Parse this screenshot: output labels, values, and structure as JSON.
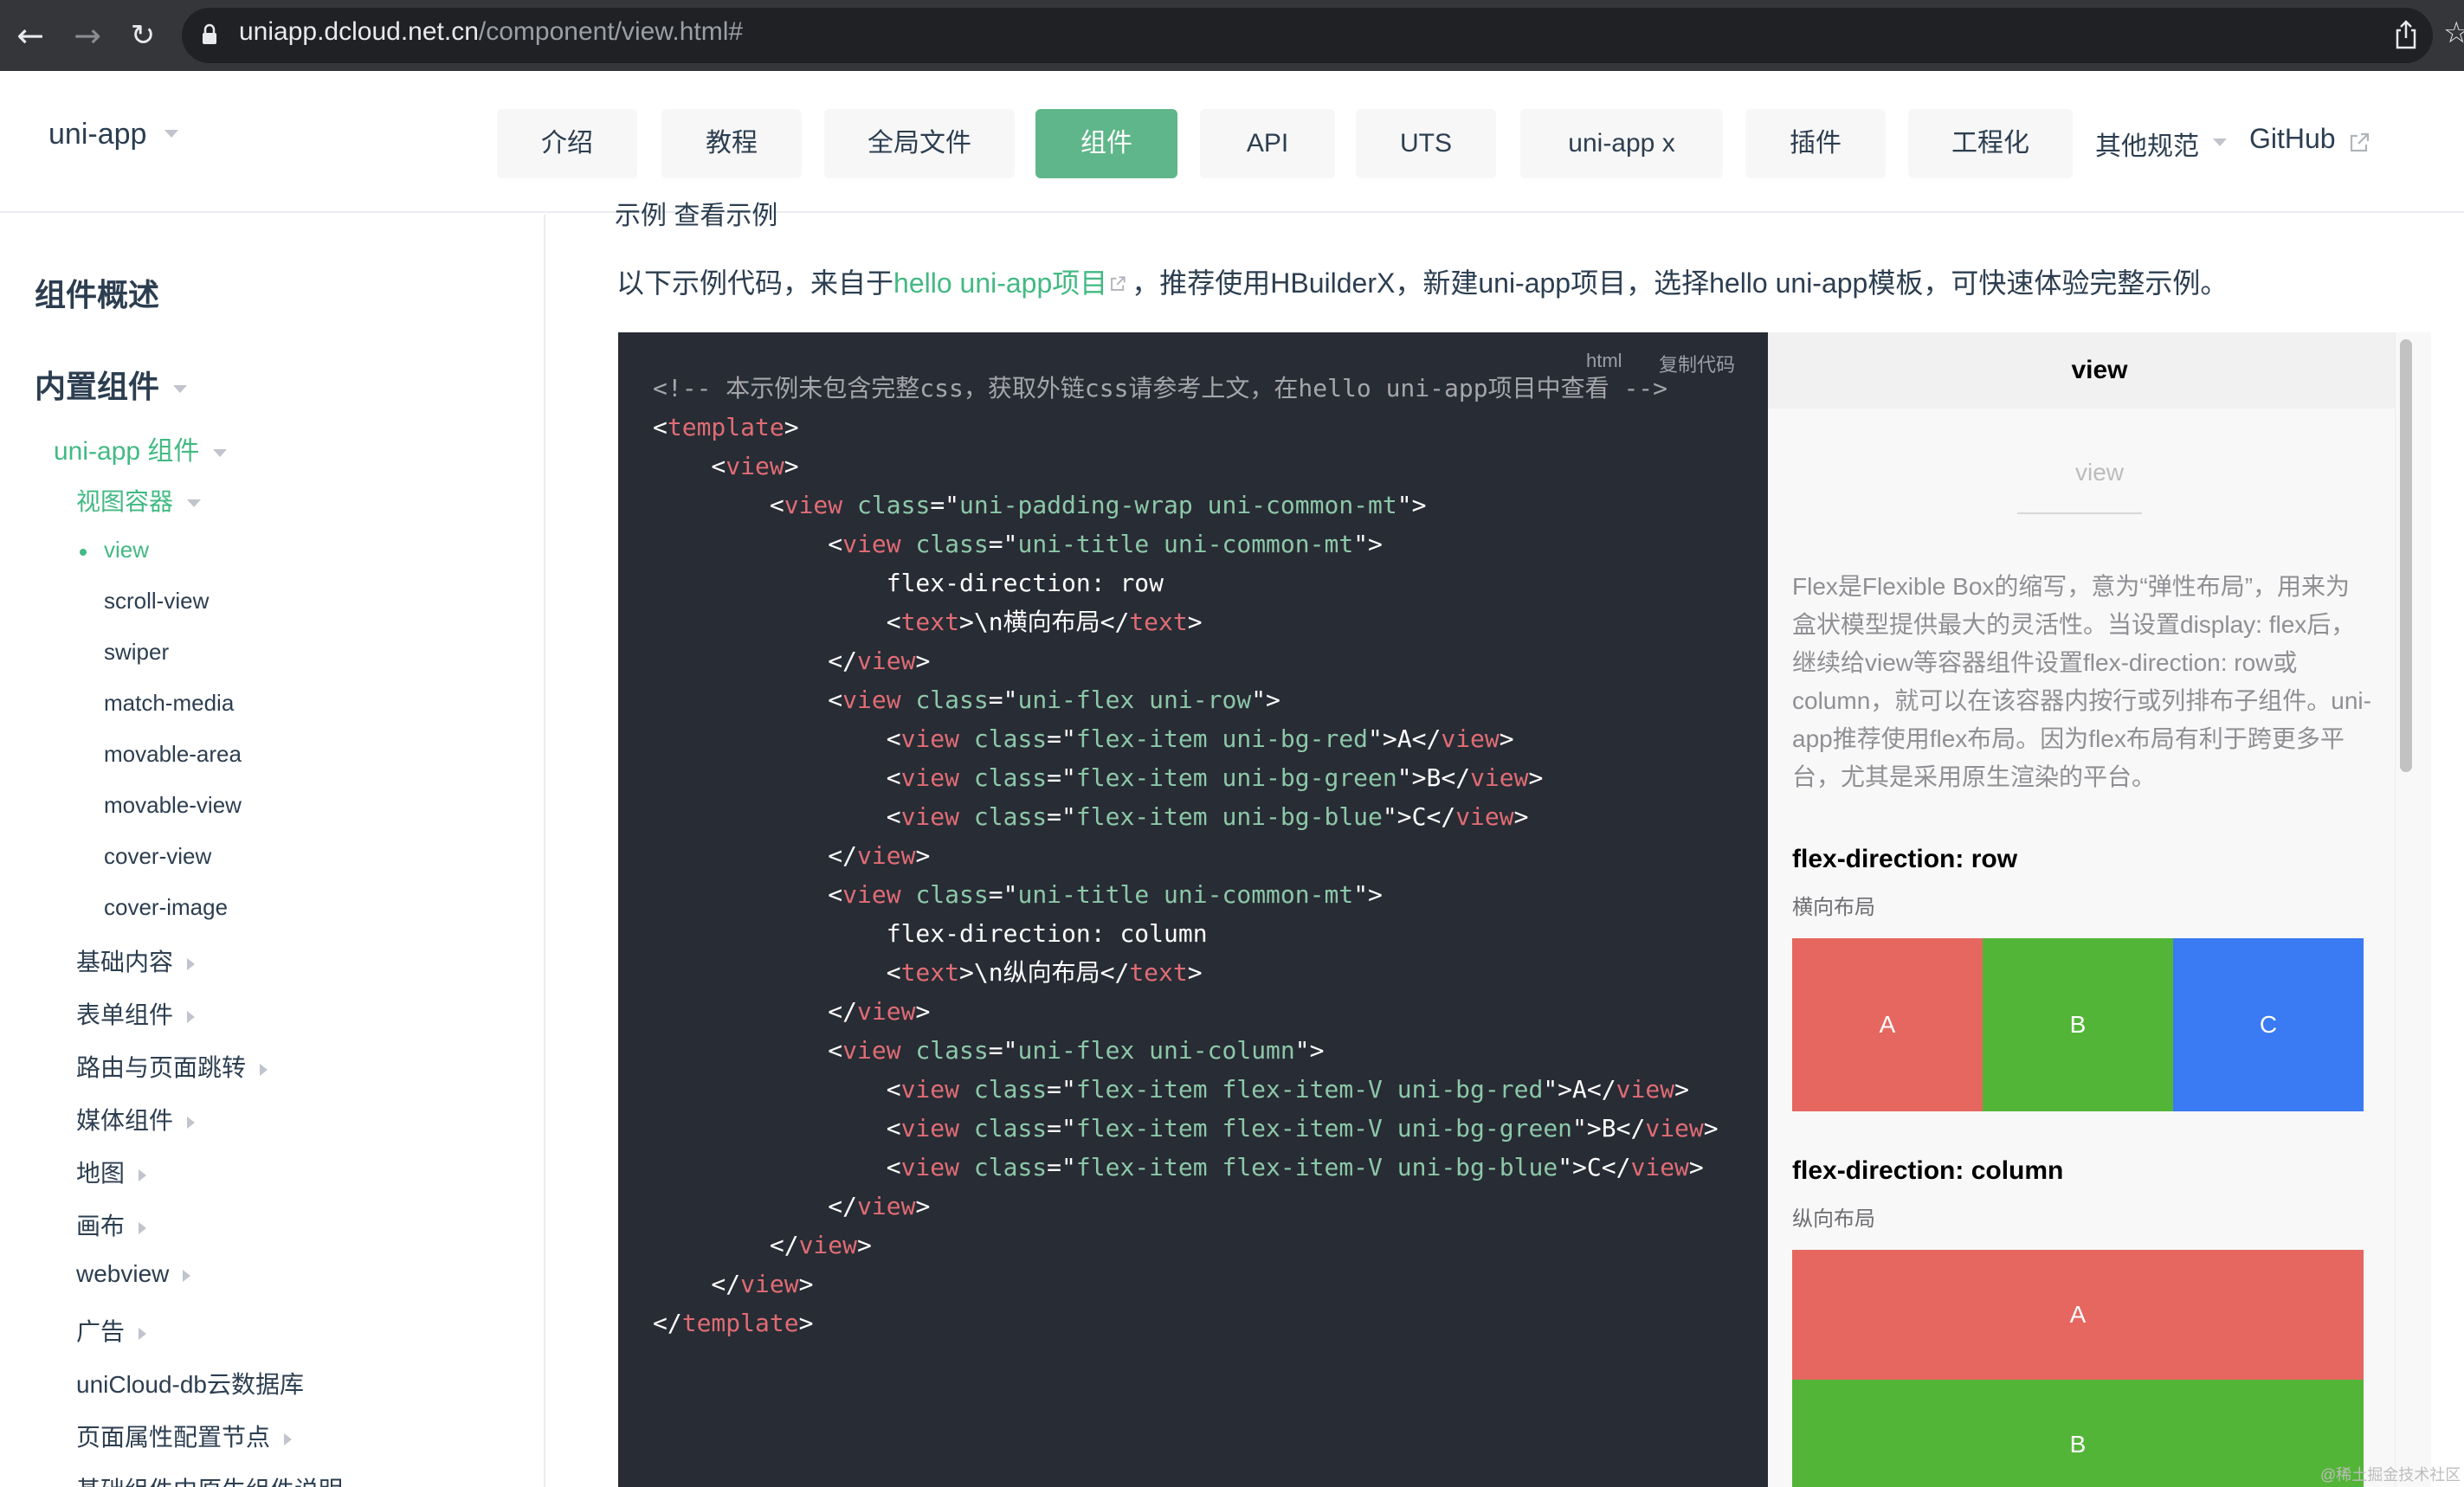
{
  "browser": {
    "url_host": "uniapp.dcloud.net.cn",
    "url_path": "/component/view.html#"
  },
  "navbar": {
    "brand": "uni-app",
    "tabs": [
      {
        "label": "介绍"
      },
      {
        "label": "教程"
      },
      {
        "label": "全局文件"
      },
      {
        "label": "组件",
        "active": true
      },
      {
        "label": "API"
      },
      {
        "label": "UTS"
      },
      {
        "label": "uni-app x"
      },
      {
        "label": "插件"
      },
      {
        "label": "工程化"
      }
    ],
    "other": "其他规范",
    "github": "GitHub"
  },
  "sidebar": {
    "overview": "组件概述",
    "builtin": "内置组件",
    "uniapp_components": "uni-app 组件",
    "view_containers": "视图容器",
    "items": [
      "view",
      "scroll-view",
      "swiper",
      "match-media",
      "movable-area",
      "movable-view",
      "cover-view",
      "cover-image"
    ],
    "groups": [
      "基础内容",
      "表单组件",
      "路由与页面跳转",
      "媒体组件",
      "地图",
      "画布",
      "webview",
      "广告"
    ],
    "extra": [
      "uniCloud-db云数据库",
      "页面属性配置节点",
      "基础组件中原生组件说明"
    ]
  },
  "main": {
    "partial_top": "示例 查看示例",
    "intro_prefix": "以下示例代码，来自于",
    "intro_link": "hello uni-app项目",
    "intro_suffix": "，推荐使用HBuilderX，新建uni-app项目，选择hello uni-app模板，可快速体验完整示例。",
    "code_lang": "html",
    "copy_label": "复制代码"
  },
  "code_lines": [
    [
      {
        "t": "com",
        "v": "<!-- 本示例未包含完整css，获取外链css请参考上文，在hello uni-app项目中查看 -->"
      }
    ],
    [
      {
        "t": "pun",
        "v": "<"
      },
      {
        "t": "tag",
        "v": "template"
      },
      {
        "t": "pun",
        "v": ">"
      }
    ],
    [
      {
        "t": "pun",
        "v": "    <"
      },
      {
        "t": "tag",
        "v": "view"
      },
      {
        "t": "pun",
        "v": ">"
      }
    ],
    [
      {
        "t": "pun",
        "v": "        <"
      },
      {
        "t": "tag",
        "v": "view"
      },
      {
        "t": "attr",
        "v": " class"
      },
      {
        "t": "pun",
        "v": "=\""
      },
      {
        "t": "str",
        "v": "uni-padding-wrap uni-common-mt"
      },
      {
        "t": "pun",
        "v": "\">"
      }
    ],
    [
      {
        "t": "pun",
        "v": "            <"
      },
      {
        "t": "tag",
        "v": "view"
      },
      {
        "t": "attr",
        "v": " class"
      },
      {
        "t": "pun",
        "v": "=\""
      },
      {
        "t": "str",
        "v": "uni-title uni-common-mt"
      },
      {
        "t": "pun",
        "v": "\">"
      }
    ],
    [
      {
        "t": "pun",
        "v": "                flex-direction: row"
      }
    ],
    [
      {
        "t": "pun",
        "v": "                <"
      },
      {
        "t": "tag",
        "v": "text"
      },
      {
        "t": "pun",
        "v": ">\\n横向布局</"
      },
      {
        "t": "tag",
        "v": "text"
      },
      {
        "t": "pun",
        "v": ">"
      }
    ],
    [
      {
        "t": "pun",
        "v": "            </"
      },
      {
        "t": "tag",
        "v": "view"
      },
      {
        "t": "pun",
        "v": ">"
      }
    ],
    [
      {
        "t": "pun",
        "v": "            <"
      },
      {
        "t": "tag",
        "v": "view"
      },
      {
        "t": "attr",
        "v": " class"
      },
      {
        "t": "pun",
        "v": "=\""
      },
      {
        "t": "str",
        "v": "uni-flex uni-row"
      },
      {
        "t": "pun",
        "v": "\">"
      }
    ],
    [
      {
        "t": "pun",
        "v": "                <"
      },
      {
        "t": "tag",
        "v": "view"
      },
      {
        "t": "attr",
        "v": " class"
      },
      {
        "t": "pun",
        "v": "=\""
      },
      {
        "t": "str",
        "v": "flex-item uni-bg-red"
      },
      {
        "t": "pun",
        "v": "\">A</"
      },
      {
        "t": "tag",
        "v": "view"
      },
      {
        "t": "pun",
        "v": ">"
      }
    ],
    [
      {
        "t": "pun",
        "v": "                <"
      },
      {
        "t": "tag",
        "v": "view"
      },
      {
        "t": "attr",
        "v": " class"
      },
      {
        "t": "pun",
        "v": "=\""
      },
      {
        "t": "str",
        "v": "flex-item uni-bg-green"
      },
      {
        "t": "pun",
        "v": "\">B</"
      },
      {
        "t": "tag",
        "v": "view"
      },
      {
        "t": "pun",
        "v": ">"
      }
    ],
    [
      {
        "t": "pun",
        "v": "                <"
      },
      {
        "t": "tag",
        "v": "view"
      },
      {
        "t": "attr",
        "v": " class"
      },
      {
        "t": "pun",
        "v": "=\""
      },
      {
        "t": "str",
        "v": "flex-item uni-bg-blue"
      },
      {
        "t": "pun",
        "v": "\">C</"
      },
      {
        "t": "tag",
        "v": "view"
      },
      {
        "t": "pun",
        "v": ">"
      }
    ],
    [
      {
        "t": "pun",
        "v": "            </"
      },
      {
        "t": "tag",
        "v": "view"
      },
      {
        "t": "pun",
        "v": ">"
      }
    ],
    [
      {
        "t": "pun",
        "v": "            <"
      },
      {
        "t": "tag",
        "v": "view"
      },
      {
        "t": "attr",
        "v": " class"
      },
      {
        "t": "pun",
        "v": "=\""
      },
      {
        "t": "str",
        "v": "uni-title uni-common-mt"
      },
      {
        "t": "pun",
        "v": "\">"
      }
    ],
    [
      {
        "t": "pun",
        "v": "                flex-direction: column"
      }
    ],
    [
      {
        "t": "pun",
        "v": "                <"
      },
      {
        "t": "tag",
        "v": "text"
      },
      {
        "t": "pun",
        "v": ">\\n纵向布局</"
      },
      {
        "t": "tag",
        "v": "text"
      },
      {
        "t": "pun",
        "v": ">"
      }
    ],
    [
      {
        "t": "pun",
        "v": "            </"
      },
      {
        "t": "tag",
        "v": "view"
      },
      {
        "t": "pun",
        "v": ">"
      }
    ],
    [
      {
        "t": "pun",
        "v": "            <"
      },
      {
        "t": "tag",
        "v": "view"
      },
      {
        "t": "attr",
        "v": " class"
      },
      {
        "t": "pun",
        "v": "=\""
      },
      {
        "t": "str",
        "v": "uni-flex uni-column"
      },
      {
        "t": "pun",
        "v": "\">"
      }
    ],
    [
      {
        "t": "pun",
        "v": "                <"
      },
      {
        "t": "tag",
        "v": "view"
      },
      {
        "t": "attr",
        "v": " class"
      },
      {
        "t": "pun",
        "v": "=\""
      },
      {
        "t": "str",
        "v": "flex-item flex-item-V uni-bg-red"
      },
      {
        "t": "pun",
        "v": "\">A</"
      },
      {
        "t": "tag",
        "v": "view"
      },
      {
        "t": "pun",
        "v": ">"
      }
    ],
    [
      {
        "t": "pun",
        "v": "                <"
      },
      {
        "t": "tag",
        "v": "view"
      },
      {
        "t": "attr",
        "v": " class"
      },
      {
        "t": "pun",
        "v": "=\""
      },
      {
        "t": "str",
        "v": "flex-item flex-item-V uni-bg-green"
      },
      {
        "t": "pun",
        "v": "\">B</"
      },
      {
        "t": "tag",
        "v": "view"
      },
      {
        "t": "pun",
        "v": ">"
      }
    ],
    [
      {
        "t": "pun",
        "v": "                <"
      },
      {
        "t": "tag",
        "v": "view"
      },
      {
        "t": "attr",
        "v": " class"
      },
      {
        "t": "pun",
        "v": "=\""
      },
      {
        "t": "str",
        "v": "flex-item flex-item-V uni-bg-blue"
      },
      {
        "t": "pun",
        "v": "\">C</"
      },
      {
        "t": "tag",
        "v": "view"
      },
      {
        "t": "pun",
        "v": ">"
      }
    ],
    [
      {
        "t": "pun",
        "v": "            </"
      },
      {
        "t": "tag",
        "v": "view"
      },
      {
        "t": "pun",
        "v": ">"
      }
    ],
    [
      {
        "t": "pun",
        "v": "        </"
      },
      {
        "t": "tag",
        "v": "view"
      },
      {
        "t": "pun",
        "v": ">"
      }
    ],
    [
      {
        "t": "pun",
        "v": "    </"
      },
      {
        "t": "tag",
        "v": "view"
      },
      {
        "t": "pun",
        "v": ">"
      }
    ],
    [
      {
        "t": "pun",
        "v": "</"
      },
      {
        "t": "tag",
        "v": "template"
      },
      {
        "t": "pun",
        "v": ">"
      }
    ]
  ],
  "preview": {
    "header": "view",
    "subtitle": "view",
    "description": "Flex是Flexible Box的缩写，意为“弹性布局”，用来为盒状模型提供最大的灵活性。当设置display: flex后，继续给view等容器组件设置flex-direction: row或column，就可以在该容器内按行或列排布子组件。uni-app推荐使用flex布局。因为flex布局有利于跨更多平台，尤其是采用原生渲染的平台。",
    "row_title": "flex-direction: row",
    "row_sub": "横向布局",
    "col_title": "flex-direction: column",
    "col_sub": "纵向布局",
    "boxes": [
      "A",
      "B",
      "C"
    ],
    "colors": {
      "red": "#e5675f",
      "green": "#53b537",
      "blue": "#3a7af2"
    }
  },
  "watermark": "@稀土掘金技术社区",
  "icons": [
    "back-arrow-icon",
    "forward-arrow-icon",
    "reload-icon",
    "lock-icon",
    "share-icon",
    "star-icon",
    "caret-down-icon",
    "external-link-icon"
  ]
}
